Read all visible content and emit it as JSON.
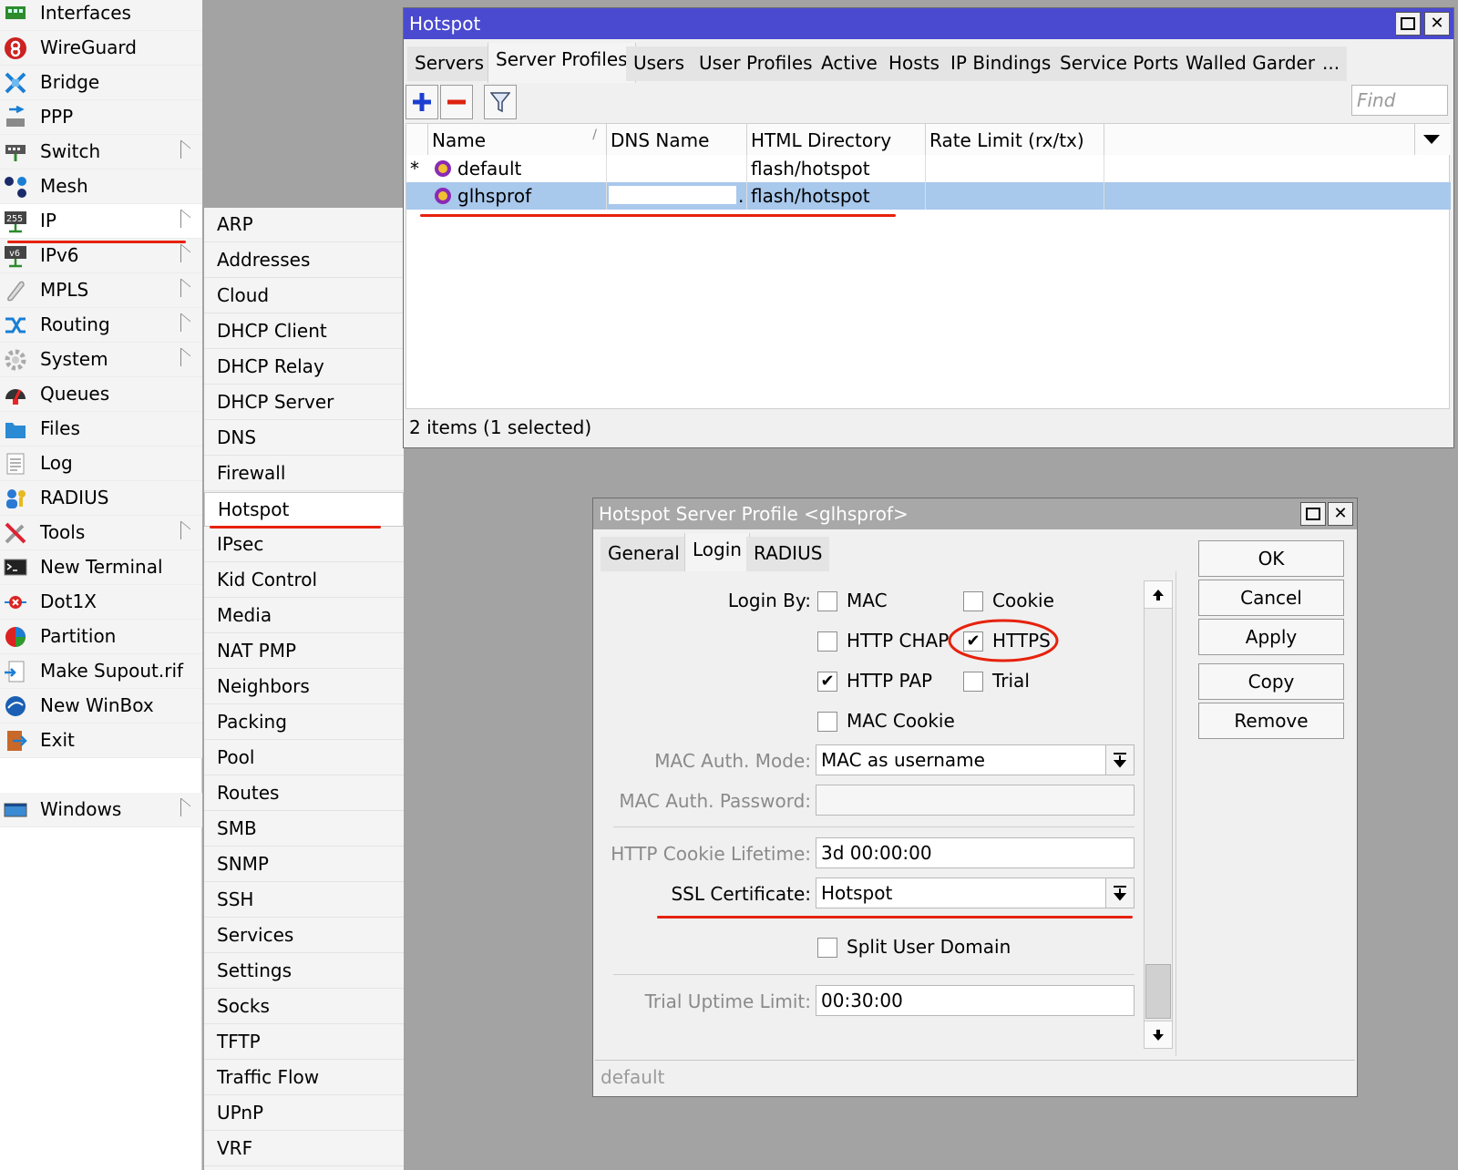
{
  "main_menu": {
    "items": [
      {
        "label": "Interfaces",
        "icon": "interfaces-icon",
        "submenu": false
      },
      {
        "label": "WireGuard",
        "icon": "wireguard-icon",
        "submenu": false
      },
      {
        "label": "Bridge",
        "icon": "bridge-icon",
        "submenu": false
      },
      {
        "label": "PPP",
        "icon": "ppp-icon",
        "submenu": false
      },
      {
        "label": "Switch",
        "icon": "switch-icon",
        "submenu": true
      },
      {
        "label": "Mesh",
        "icon": "mesh-icon",
        "submenu": false
      },
      {
        "label": "IP",
        "icon": "ip-icon",
        "submenu": true
      },
      {
        "label": "IPv6",
        "icon": "ipv6-icon",
        "submenu": true
      },
      {
        "label": "MPLS",
        "icon": "mpls-icon",
        "submenu": true
      },
      {
        "label": "Routing",
        "icon": "routing-icon",
        "submenu": true
      },
      {
        "label": "System",
        "icon": "system-icon",
        "submenu": true
      },
      {
        "label": "Queues",
        "icon": "queues-icon",
        "submenu": false
      },
      {
        "label": "Files",
        "icon": "files-icon",
        "submenu": false
      },
      {
        "label": "Log",
        "icon": "log-icon",
        "submenu": false
      },
      {
        "label": "RADIUS",
        "icon": "radius-icon",
        "submenu": false
      },
      {
        "label": "Tools",
        "icon": "tools-icon",
        "submenu": true
      },
      {
        "label": "New Terminal",
        "icon": "terminal-icon",
        "submenu": false
      },
      {
        "label": "Dot1X",
        "icon": "dot1x-icon",
        "submenu": false
      },
      {
        "label": "Partition",
        "icon": "partition-icon",
        "submenu": false
      },
      {
        "label": "Make Supout.rif",
        "icon": "supout-icon",
        "submenu": false
      },
      {
        "label": "New WinBox",
        "icon": "winbox-icon",
        "submenu": false
      },
      {
        "label": "Exit",
        "icon": "exit-icon",
        "submenu": false
      },
      {
        "label": "Windows",
        "icon": "windows-icon",
        "submenu": true
      }
    ]
  },
  "ip_submenu": {
    "items": [
      "ARP",
      "Addresses",
      "Cloud",
      "DHCP Client",
      "DHCP Relay",
      "DHCP Server",
      "DNS",
      "Firewall",
      "Hotspot",
      "IPsec",
      "Kid Control",
      "Media",
      "NAT PMP",
      "Neighbors",
      "Packing",
      "Pool",
      "Routes",
      "SMB",
      "SNMP",
      "SSH",
      "Services",
      "Settings",
      "Socks",
      "TFTP",
      "Traffic Flow",
      "UPnP",
      "VRF"
    ],
    "active": "Hotspot"
  },
  "hotspot_window": {
    "title": "Hotspot",
    "tabs": [
      "Servers",
      "Server Profiles",
      "Users",
      "User Profiles",
      "Active",
      "Hosts",
      "IP Bindings",
      "Service Ports",
      "Walled Garden",
      "..."
    ],
    "active_tab": "Server Profiles",
    "find_placeholder": "Find",
    "columns": [
      "Name",
      "DNS Name",
      "HTML Directory",
      "Rate Limit (rx/tx)"
    ],
    "rows": [
      {
        "marker": "*",
        "name": "default",
        "dns_name": "",
        "html_directory": "flash/hotspot",
        "rate_limit": ""
      },
      {
        "marker": "",
        "name": "glhsprof",
        "dns_name": ".",
        "html_directory": "flash/hotspot",
        "rate_limit": ""
      }
    ],
    "status": "2 items (1 selected)"
  },
  "profile_dialog": {
    "title": "Hotspot Server Profile <glhsprof>",
    "tabs": [
      "General",
      "Login",
      "RADIUS"
    ],
    "active_tab": "Login",
    "login_by_label": "Login By:",
    "checkboxes": {
      "mac": {
        "label": "MAC",
        "checked": false
      },
      "cookie": {
        "label": "Cookie",
        "checked": false
      },
      "http_chap": {
        "label": "HTTP CHAP",
        "checked": false
      },
      "https": {
        "label": "HTTPS",
        "checked": true
      },
      "http_pap": {
        "label": "HTTP PAP",
        "checked": true
      },
      "trial": {
        "label": "Trial",
        "checked": false
      },
      "mac_cookie": {
        "label": "MAC Cookie",
        "checked": false
      },
      "split_user_domain": {
        "label": "Split User Domain",
        "checked": false
      }
    },
    "check_glyph": "✔",
    "mac_auth_mode_label": "MAC Auth. Mode:",
    "mac_auth_mode_value": "MAC as username",
    "mac_auth_password_label": "MAC Auth. Password:",
    "mac_auth_password_value": "",
    "http_cookie_lifetime_label": "HTTP Cookie Lifetime:",
    "http_cookie_lifetime_value": "3d 00:00:00",
    "ssl_certificate_label": "SSL Certificate:",
    "ssl_certificate_value": "Hotspot",
    "trial_uptime_limit_label": "Trial Uptime Limit:",
    "trial_uptime_limit_value": "00:30:00",
    "buttons": {
      "ok": "OK",
      "cancel": "Cancel",
      "apply": "Apply",
      "copy": "Copy",
      "remove": "Remove"
    },
    "status": "default"
  },
  "colors": {
    "active_titlebar": "#4a4ad0",
    "inactive_titlebar": "#a8a8a8",
    "selected_row": "#a8c8ec",
    "annotation_red": "#e6220c"
  }
}
